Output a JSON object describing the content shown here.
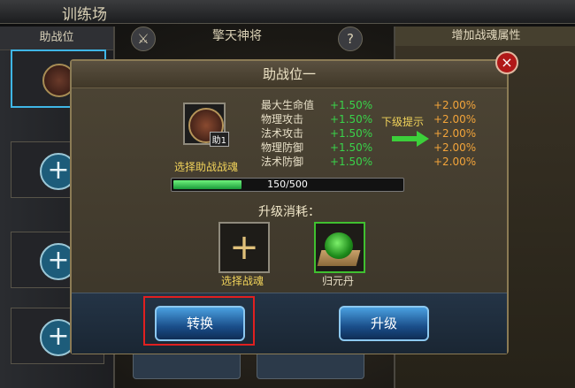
{
  "screen": {
    "title": "训练场"
  },
  "left_panel": {
    "header": "助战位"
  },
  "middle": {
    "hero_name": "擎天神将",
    "help_icon": "?"
  },
  "right_panel": {
    "header": "增加战魂属性"
  },
  "modal": {
    "title": "助战位一",
    "close_icon": "×",
    "card_badge": "助1",
    "select_label": "选择助战战魂",
    "next_hint": "下级提示",
    "stats": [
      {
        "name": "最大生命值",
        "current": "+1.50%",
        "next": "+2.00%"
      },
      {
        "name": "物理攻击",
        "current": "+1.50%",
        "next": "+2.00%"
      },
      {
        "name": "法术攻击",
        "current": "+1.50%",
        "next": "+2.00%"
      },
      {
        "name": "物理防御",
        "current": "+1.50%",
        "next": "+2.00%"
      },
      {
        "name": "法术防御",
        "current": "+1.50%",
        "next": "+2.00%"
      }
    ],
    "progress": {
      "text": "150/500",
      "value": 150,
      "max": 500
    },
    "cost_label": "升级消耗：",
    "items": [
      {
        "label": "选择战魂"
      },
      {
        "label": "归元丹"
      }
    ],
    "buttons": {
      "convert": "转换",
      "upgrade": "升级"
    }
  },
  "colors": {
    "stat_current": "#39d34a",
    "stat_next": "#f3a43a",
    "highlight": "#e02020"
  }
}
